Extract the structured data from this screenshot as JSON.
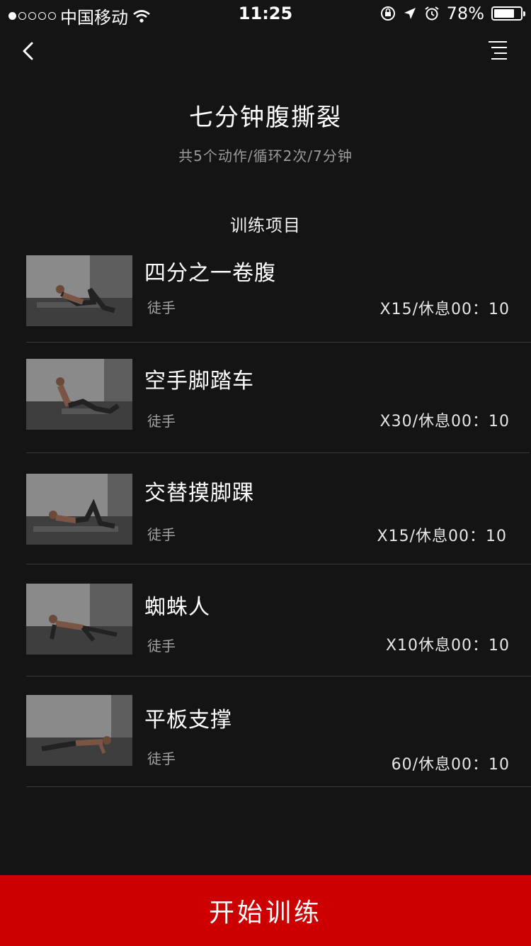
{
  "status_bar": {
    "carrier": "中国移动",
    "time": "11:25",
    "battery": "78%",
    "battery_level": 0.78,
    "signal_dots": [
      true,
      false,
      false,
      false,
      false
    ]
  },
  "nav": {
    "back_icon": "chevron-left-icon",
    "menu_icon": "list-menu-icon"
  },
  "header": {
    "title": "七分钟腹撕裂",
    "subtitle": "共5个动作/循环2次/7分钟"
  },
  "section": {
    "title": "训练项目"
  },
  "exercises": [
    {
      "name": "四分之一卷腹",
      "equipment": "徒手",
      "reps": "X15/休息00：10"
    },
    {
      "name": "空手脚踏车",
      "equipment": "徒手",
      "reps": "X30/休息00：10"
    },
    {
      "name": "交替摸脚踝",
      "equipment": "徒手",
      "reps": "X15/休息00：10"
    },
    {
      "name": "蜘蛛人",
      "equipment": "徒手",
      "reps": "X10休息00：10"
    },
    {
      "name": "平板支撑",
      "equipment": "徒手",
      "reps": "60/休息00：10"
    }
  ],
  "footer": {
    "start_label": "开始训练",
    "accent": "#cc0000"
  }
}
